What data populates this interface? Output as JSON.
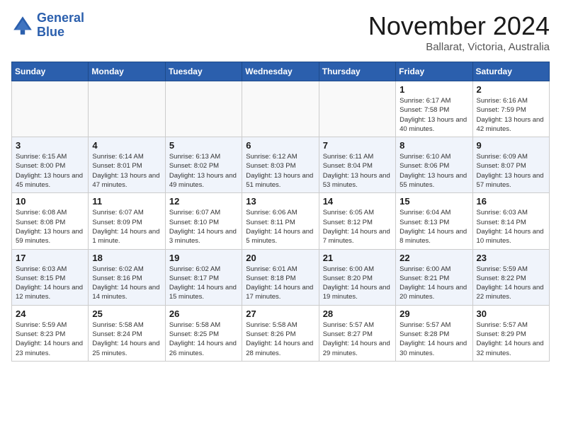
{
  "header": {
    "logo_line1": "General",
    "logo_line2": "Blue",
    "month_title": "November 2024",
    "location": "Ballarat, Victoria, Australia"
  },
  "weekdays": [
    "Sunday",
    "Monday",
    "Tuesday",
    "Wednesday",
    "Thursday",
    "Friday",
    "Saturday"
  ],
  "weeks": [
    [
      {
        "day": "",
        "sunrise": "",
        "sunset": "",
        "daylight": ""
      },
      {
        "day": "",
        "sunrise": "",
        "sunset": "",
        "daylight": ""
      },
      {
        "day": "",
        "sunrise": "",
        "sunset": "",
        "daylight": ""
      },
      {
        "day": "",
        "sunrise": "",
        "sunset": "",
        "daylight": ""
      },
      {
        "day": "",
        "sunrise": "",
        "sunset": "",
        "daylight": ""
      },
      {
        "day": "1",
        "sunrise": "Sunrise: 6:17 AM",
        "sunset": "Sunset: 7:58 PM",
        "daylight": "Daylight: 13 hours and 40 minutes."
      },
      {
        "day": "2",
        "sunrise": "Sunrise: 6:16 AM",
        "sunset": "Sunset: 7:59 PM",
        "daylight": "Daylight: 13 hours and 42 minutes."
      }
    ],
    [
      {
        "day": "3",
        "sunrise": "Sunrise: 6:15 AM",
        "sunset": "Sunset: 8:00 PM",
        "daylight": "Daylight: 13 hours and 45 minutes."
      },
      {
        "day": "4",
        "sunrise": "Sunrise: 6:14 AM",
        "sunset": "Sunset: 8:01 PM",
        "daylight": "Daylight: 13 hours and 47 minutes."
      },
      {
        "day": "5",
        "sunrise": "Sunrise: 6:13 AM",
        "sunset": "Sunset: 8:02 PM",
        "daylight": "Daylight: 13 hours and 49 minutes."
      },
      {
        "day": "6",
        "sunrise": "Sunrise: 6:12 AM",
        "sunset": "Sunset: 8:03 PM",
        "daylight": "Daylight: 13 hours and 51 minutes."
      },
      {
        "day": "7",
        "sunrise": "Sunrise: 6:11 AM",
        "sunset": "Sunset: 8:04 PM",
        "daylight": "Daylight: 13 hours and 53 minutes."
      },
      {
        "day": "8",
        "sunrise": "Sunrise: 6:10 AM",
        "sunset": "Sunset: 8:06 PM",
        "daylight": "Daylight: 13 hours and 55 minutes."
      },
      {
        "day": "9",
        "sunrise": "Sunrise: 6:09 AM",
        "sunset": "Sunset: 8:07 PM",
        "daylight": "Daylight: 13 hours and 57 minutes."
      }
    ],
    [
      {
        "day": "10",
        "sunrise": "Sunrise: 6:08 AM",
        "sunset": "Sunset: 8:08 PM",
        "daylight": "Daylight: 13 hours and 59 minutes."
      },
      {
        "day": "11",
        "sunrise": "Sunrise: 6:07 AM",
        "sunset": "Sunset: 8:09 PM",
        "daylight": "Daylight: 14 hours and 1 minute."
      },
      {
        "day": "12",
        "sunrise": "Sunrise: 6:07 AM",
        "sunset": "Sunset: 8:10 PM",
        "daylight": "Daylight: 14 hours and 3 minutes."
      },
      {
        "day": "13",
        "sunrise": "Sunrise: 6:06 AM",
        "sunset": "Sunset: 8:11 PM",
        "daylight": "Daylight: 14 hours and 5 minutes."
      },
      {
        "day": "14",
        "sunrise": "Sunrise: 6:05 AM",
        "sunset": "Sunset: 8:12 PM",
        "daylight": "Daylight: 14 hours and 7 minutes."
      },
      {
        "day": "15",
        "sunrise": "Sunrise: 6:04 AM",
        "sunset": "Sunset: 8:13 PM",
        "daylight": "Daylight: 14 hours and 8 minutes."
      },
      {
        "day": "16",
        "sunrise": "Sunrise: 6:03 AM",
        "sunset": "Sunset: 8:14 PM",
        "daylight": "Daylight: 14 hours and 10 minutes."
      }
    ],
    [
      {
        "day": "17",
        "sunrise": "Sunrise: 6:03 AM",
        "sunset": "Sunset: 8:15 PM",
        "daylight": "Daylight: 14 hours and 12 minutes."
      },
      {
        "day": "18",
        "sunrise": "Sunrise: 6:02 AM",
        "sunset": "Sunset: 8:16 PM",
        "daylight": "Daylight: 14 hours and 14 minutes."
      },
      {
        "day": "19",
        "sunrise": "Sunrise: 6:02 AM",
        "sunset": "Sunset: 8:17 PM",
        "daylight": "Daylight: 14 hours and 15 minutes."
      },
      {
        "day": "20",
        "sunrise": "Sunrise: 6:01 AM",
        "sunset": "Sunset: 8:18 PM",
        "daylight": "Daylight: 14 hours and 17 minutes."
      },
      {
        "day": "21",
        "sunrise": "Sunrise: 6:00 AM",
        "sunset": "Sunset: 8:20 PM",
        "daylight": "Daylight: 14 hours and 19 minutes."
      },
      {
        "day": "22",
        "sunrise": "Sunrise: 6:00 AM",
        "sunset": "Sunset: 8:21 PM",
        "daylight": "Daylight: 14 hours and 20 minutes."
      },
      {
        "day": "23",
        "sunrise": "Sunrise: 5:59 AM",
        "sunset": "Sunset: 8:22 PM",
        "daylight": "Daylight: 14 hours and 22 minutes."
      }
    ],
    [
      {
        "day": "24",
        "sunrise": "Sunrise: 5:59 AM",
        "sunset": "Sunset: 8:23 PM",
        "daylight": "Daylight: 14 hours and 23 minutes."
      },
      {
        "day": "25",
        "sunrise": "Sunrise: 5:58 AM",
        "sunset": "Sunset: 8:24 PM",
        "daylight": "Daylight: 14 hours and 25 minutes."
      },
      {
        "day": "26",
        "sunrise": "Sunrise: 5:58 AM",
        "sunset": "Sunset: 8:25 PM",
        "daylight": "Daylight: 14 hours and 26 minutes."
      },
      {
        "day": "27",
        "sunrise": "Sunrise: 5:58 AM",
        "sunset": "Sunset: 8:26 PM",
        "daylight": "Daylight: 14 hours and 28 minutes."
      },
      {
        "day": "28",
        "sunrise": "Sunrise: 5:57 AM",
        "sunset": "Sunset: 8:27 PM",
        "daylight": "Daylight: 14 hours and 29 minutes."
      },
      {
        "day": "29",
        "sunrise": "Sunrise: 5:57 AM",
        "sunset": "Sunset: 8:28 PM",
        "daylight": "Daylight: 14 hours and 30 minutes."
      },
      {
        "day": "30",
        "sunrise": "Sunrise: 5:57 AM",
        "sunset": "Sunset: 8:29 PM",
        "daylight": "Daylight: 14 hours and 32 minutes."
      }
    ]
  ]
}
